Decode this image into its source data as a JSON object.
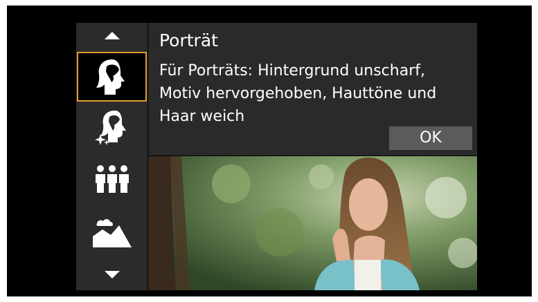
{
  "mode_screen": {
    "title": "Porträt",
    "description": "Für Porträts: Hintergrund unscharf, Motiv hervorgehoben, Hauttöne und Haar weich",
    "ok_label": "OK"
  },
  "sidebar": {
    "items": [
      {
        "icon": "portrait-icon",
        "selected": true
      },
      {
        "icon": "smooth-skin-icon",
        "selected": false
      },
      {
        "icon": "group-photo-icon",
        "selected": false
      },
      {
        "icon": "landscape-icon",
        "selected": false
      }
    ]
  },
  "colors": {
    "selection_border": "#e39a33",
    "panel_bg": "#2a2a2a",
    "ok_button_bg": "#5b5b5b"
  }
}
